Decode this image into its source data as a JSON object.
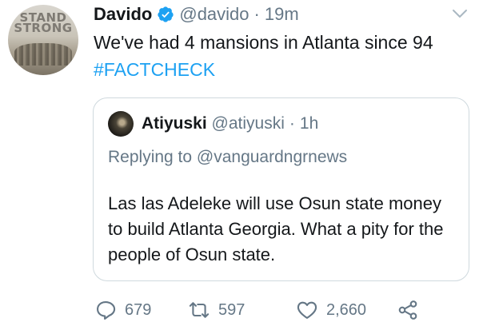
{
  "tweet": {
    "avatar": {
      "icon": "avatar-image",
      "line1": "STAND",
      "line2": "STRONG"
    },
    "author_name": "Davido",
    "verified_icon": "verified-badge-icon",
    "author_handle": "@davido",
    "separator": "·",
    "time": "19m",
    "text_main": "We've had 4 mansions in Atlanta since 94 ",
    "hashtag": "#FACTCHECK"
  },
  "quoted": {
    "author_name": "Atiyuski",
    "author_handle": "@atiyuski",
    "separator": "·",
    "time": "1h",
    "replying_to": "Replying to @vanguardngrnews",
    "text": "Las las Adeleke will use Osun state money to build Atlanta Georgia. What a pity for the people of Osun state."
  },
  "actions": {
    "reply_count": "679",
    "retweet_count": "597",
    "like_count": "2,660"
  },
  "colors": {
    "text": "#14171a",
    "muted": "#657786",
    "accent": "#1da1f2",
    "border": "#cfd9de"
  }
}
